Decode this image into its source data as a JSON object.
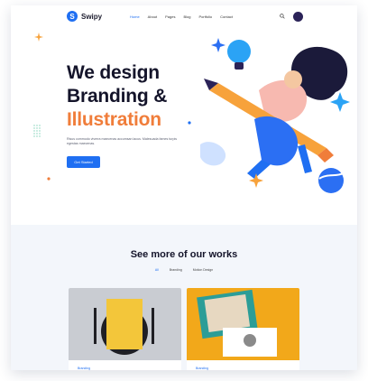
{
  "brand": {
    "name": "Swipy"
  },
  "nav": {
    "items": [
      "Home",
      "About",
      "Pages",
      "Blog",
      "Portfolio",
      "Contact"
    ],
    "active": "Home"
  },
  "hero": {
    "line1": "We design",
    "line2": "Branding &",
    "line3": "Illustration",
    "description": "Risus commodo viverra maecenas accumsan lacus. Malesuada fames turpis egestas maecenas.",
    "cta_label": "Get Started"
  },
  "works": {
    "title": "See more of our works",
    "filters": [
      "All",
      "Branding",
      "Motion Design"
    ],
    "active_filter": "All",
    "cards": [
      {
        "category": "Branding"
      },
      {
        "category": "Branding"
      }
    ]
  },
  "colors": {
    "accent": "#1f6ff2",
    "highlight": "#f07d3a",
    "ink": "#14142a"
  }
}
